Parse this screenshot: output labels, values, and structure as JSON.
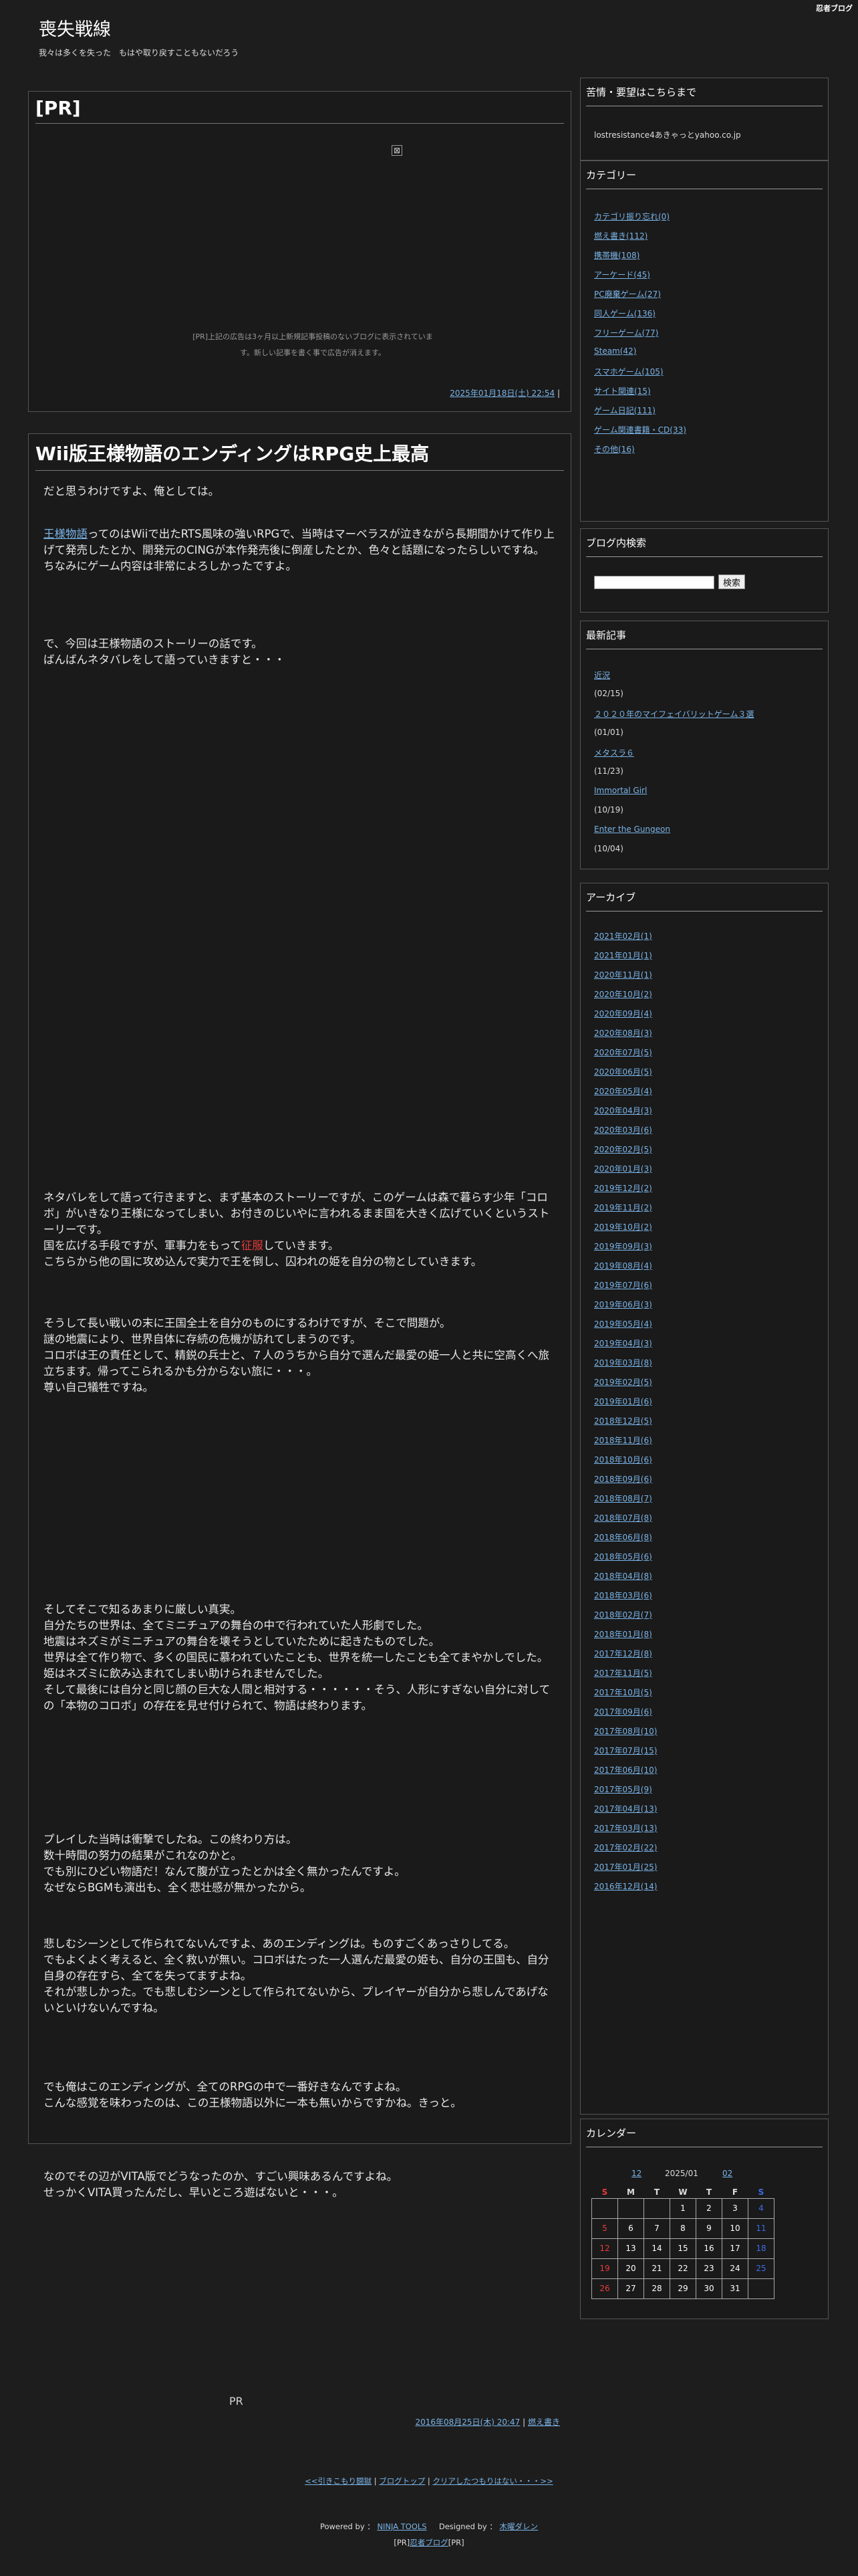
{
  "topbar": {
    "ninja_blog": "忍者ブログ"
  },
  "site": {
    "title": "喪失戦線",
    "description": "我々は多くを失った　もはや取り戻すこともないだろう"
  },
  "pr_post": {
    "title": "[PR]",
    "note": "[PR]上記の広告は3ヶ月以上新規記事投稿のないブログに表示されています。新しい記事を書く事で広告が消えます。",
    "date": "2025年01月18日(土) 22:54",
    "sep": "|"
  },
  "post": {
    "title": "Wii版王様物語のエンディングはRPG史上最高",
    "p1": "だと思うわけですよ、俺としては。",
    "p2_link": "王様物語",
    "p2_rest": "ってのはWiiで出たRTS風味の強いRPGで、当時はマーベラスが泣きながら長期間かけて作り上げて発売したとか、開発元のCINGが本作発売後に倒産したとか、色々と話題になったらしいですね。",
    "p2_b": "ちなみにゲーム内容は非常によろしかったですよ。",
    "p3_a": "で、今回は王様物語のストーリーの話です。",
    "p3_b": "ばんばんネタバレをして語っていきますと・・・",
    "p4_a": "ネタバレをして語って行きますと、まず基本のストーリーですが、このゲームは森で暮らす少年「コロボ」がいきなり王様になってしまい、お付きのじいやに言われるまま国を大きく広げていくというストーリーです。",
    "p4_b1": "国を広げる手段ですが、軍事力をもって",
    "p4_b_red": "征服",
    "p4_b2": "していきます。",
    "p4_c": "こちらから他の国に攻め込んで実力で王を倒し、囚われの姫を自分の物としていきます。",
    "p5_a": "そうして長い戦いの末に王国全土を自分のものにするわけですが、そこで問題が。",
    "p5_b": "謎の地震により、世界自体に存続の危機が訪れてしまうのです。",
    "p5_c": "コロボは王の責任として、精鋭の兵士と、７人のうちから自分で選んだ最愛の姫一人と共に空高くへ旅立ちます。帰ってこられるかも分からない旅に・・・。",
    "p5_d": "尊い自己犠牲ですね。",
    "p6_a": "そしてそこで知るあまりに厳しい真実。",
    "p6_b": "自分たちの世界は、全てミニチュアの舞台の中で行われていた人形劇でした。",
    "p6_c": "地震はネズミがミニチュアの舞台を壊そうとしていたために起きたものでした。",
    "p6_d": "世界は全て作り物で、多くの国民に慕われていたことも、世界を統一したことも全てまやかしでした。",
    "p6_e": "姫はネズミに飲み込まれてしまい助けられませんでした。",
    "p6_f": "そして最後には自分と同じ顔の巨大な人間と相対する・・・・・・そう、人形にすぎない自分に対しての「本物のコロボ」の存在を見せ付けられて、物語は終わります。",
    "p7_a": "プレイした当時は衝撃でしたね。この終わり方は。",
    "p7_b": "数十時間の努力の結果がこれなのかと。",
    "p7_c": "でも別にひどい物語だ！なんて腹が立ったとかは全く無かったんですよ。",
    "p7_d": "なぜならBGMも演出も、全く悲壮感が無かったから。",
    "p8_a": "悲しむシーンとして作られてないんですよ、あのエンディングは。ものすごくあっさりしてる。",
    "p8_b": "でもよくよく考えると、全く救いが無い。コロボはたった一人選んだ最愛の姫も、自分の王国も、自分自身の存在すら、全てを失ってますよね。",
    "p8_c": "それが悲しかった。でも悲しむシーンとして作られてないから、プレイヤーが自分から悲しんであげないといけないんですね。",
    "p9_a": "でも俺はこのエンディングが、全てのRPGの中で一番好きなんですよね。",
    "p9_b": "こんな感覚を味わったのは、この王様物語以外に一本も無いからですかね。きっと。",
    "p10_a": "なのでその辺がVITA版でどうなったのか、すごい興味あるんですよね。",
    "p10_b": "せっかくVITA買ったんだし、早いところ遊ばないと・・・。",
    "pr": "PR",
    "date": "2016年08月25日(木) 20:47",
    "sep": "|",
    "category": "燃え書き"
  },
  "sidebar": {
    "contact": {
      "title": "苦情・要望はこちらまで",
      "email": "lostresistance4あきゃっとyahoo.co.jp"
    },
    "categories": {
      "title": "カテゴリー",
      "items": [
        "カテゴリ振り忘れ(0)",
        "燃え書き(112)",
        "携帯機(108)",
        "アーケード(45)",
        "PC廃棄ゲーム(27)",
        "同人ゲーム(136)",
        "フリーゲーム(77)",
        "Steam(42)",
        "スマホゲーム(105)",
        "サイト関連(15)",
        "ゲーム日記(111)",
        "ゲーム関連書籍・CD(33)",
        "その他(16)"
      ]
    },
    "search": {
      "title": "ブログ内検索",
      "button": "検索"
    },
    "recent": {
      "title": "最新記事",
      "items": [
        {
          "title": "近況",
          "date": "(02/15)"
        },
        {
          "title": "２０２０年のマイフェイバリットゲーム３選",
          "date": "(01/01)"
        },
        {
          "title": "メタスラ６",
          "date": "(11/23)"
        },
        {
          "title": "Immortal Girl",
          "date": "(10/19)"
        },
        {
          "title": "Enter the Gungeon",
          "date": "(10/04)"
        }
      ]
    },
    "archive": {
      "title": "アーカイブ",
      "items": [
        "2021年02月(1)",
        "2021年01月(1)",
        "2020年11月(1)",
        "2020年10月(2)",
        "2020年09月(4)",
        "2020年08月(3)",
        "2020年07月(5)",
        "2020年06月(5)",
        "2020年05月(4)",
        "2020年04月(3)",
        "2020年03月(6)",
        "2020年02月(5)",
        "2020年01月(3)",
        "2019年12月(2)",
        "2019年11月(2)",
        "2019年10月(2)",
        "2019年09月(3)",
        "2019年08月(4)",
        "2019年07月(6)",
        "2019年06月(3)",
        "2019年05月(4)",
        "2019年04月(3)",
        "2019年03月(8)",
        "2019年02月(5)",
        "2019年01月(6)",
        "2018年12月(5)",
        "2018年11月(6)",
        "2018年10月(6)",
        "2018年09月(6)",
        "2018年08月(7)",
        "2018年07月(8)",
        "2018年06月(8)",
        "2018年05月(6)",
        "2018年04月(8)",
        "2018年03月(6)",
        "2018年02月(7)",
        "2018年01月(8)",
        "2017年12月(8)",
        "2017年11月(5)",
        "2017年10月(5)",
        "2017年09月(6)",
        "2017年08月(10)",
        "2017年07月(15)",
        "2017年06月(10)",
        "2017年05月(9)",
        "2017年04月(13)",
        "2017年03月(13)",
        "2017年02月(22)",
        "2017年01月(25)",
        "2016年12月(14)"
      ]
    },
    "calendar": {
      "title": "カレンダー",
      "prev": "12",
      "current": "2025/01",
      "next": "02",
      "weekdays": [
        "S",
        "M",
        "T",
        "W",
        "T",
        "F",
        "S"
      ],
      "weeks": [
        [
          "",
          "",
          "",
          "1",
          "2",
          "3",
          "4"
        ],
        [
          "5",
          "6",
          "7",
          "8",
          "9",
          "10",
          "11"
        ],
        [
          "12",
          "13",
          "14",
          "15",
          "16",
          "17",
          "18"
        ],
        [
          "19",
          "20",
          "21",
          "22",
          "23",
          "24",
          "25"
        ],
        [
          "26",
          "27",
          "28",
          "29",
          "30",
          "31",
          ""
        ]
      ]
    }
  },
  "footer": {
    "nav_prev": "<<引きこもり闘獄",
    "nav_sep": "|",
    "nav_top": "ブログトップ",
    "nav_next": "クリアしたつもりはない・・・>>",
    "powered_label": "Powered by ：",
    "powered_link": "NINJA TOOLS",
    "designed_label": "Designed by ：",
    "designed_link": "木曜ダレン",
    "pr_left": "[PR]",
    "pr_link": "忍者ブログ",
    "pr_right": "[PR]"
  },
  "colors": {
    "background": "#1d1d1d",
    "link": "#7ab4e8",
    "accent_red": "#e83c3c",
    "saturday": "#3c6ce8"
  }
}
